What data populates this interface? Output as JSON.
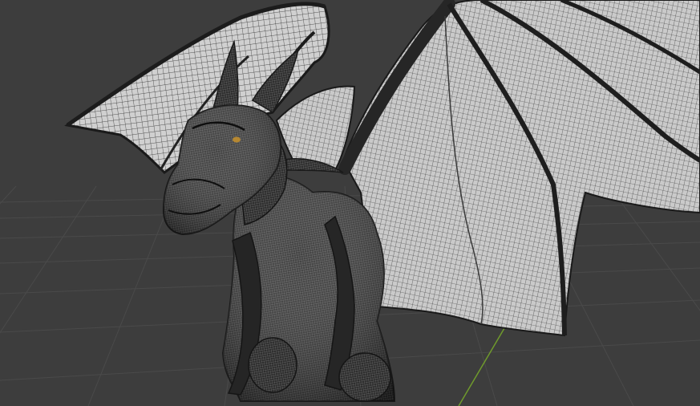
{
  "viewport": {
    "mode": "wireframe",
    "background": "#3d3d3d",
    "grid_color": "#4b4b4b",
    "axis_y_color": "#6f9a2c"
  },
  "model": {
    "icon": "winged-dragon-wireframe-mesh",
    "body_color": "#2b2b2b",
    "wing_membrane_color": "#d2d2d2",
    "wire_color": "#1a1a1a",
    "eye_color": "#c7912c"
  }
}
